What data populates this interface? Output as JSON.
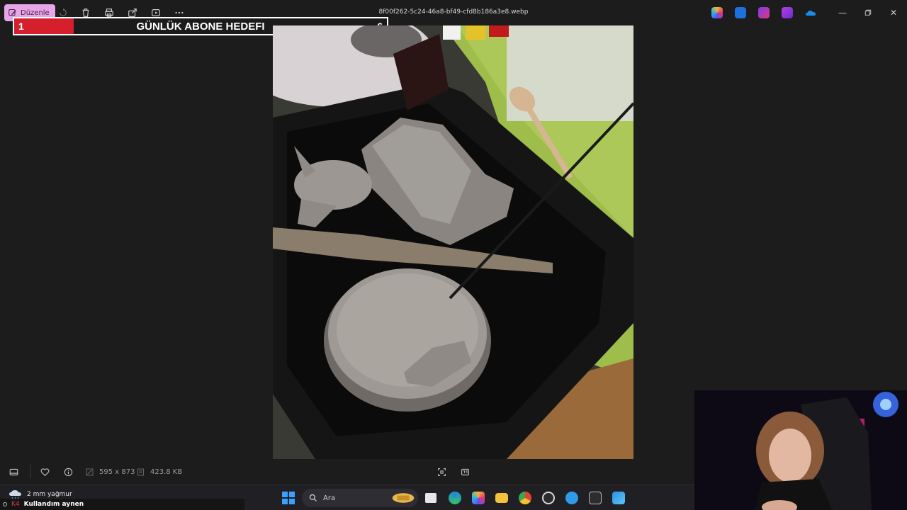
{
  "titlebar": {
    "edit_label": "Düzenle",
    "filename": "8f00f262-5c24-46a8-bf49-cfd8b186a3e8.webp",
    "tool_icons": [
      "rotate-icon",
      "delete-icon",
      "print-icon",
      "share-icon",
      "slideshow-icon",
      "more-icon"
    ],
    "tray_apps": [
      "copilot-icon",
      "photo-editor-icon",
      "clipchamp-icon",
      "designer-icon",
      "onedrive-icon"
    ],
    "window_controls": [
      "minimize",
      "restore",
      "close"
    ]
  },
  "goal": {
    "current": "1",
    "title": "GÜNLÜK ABONE HEDEFI",
    "target": "6",
    "fill_fraction": 0.16,
    "fill_color": "#d61f2c"
  },
  "infobar": {
    "dimensions": "595 x 873",
    "file_size": "423.8 KB"
  },
  "taskbar": {
    "weather_text": "2 mm yağmur",
    "search_placeholder": "Ara",
    "apps": [
      "file-explorer-icon",
      "task-view-icon",
      "edge-icon",
      "copilot-icon",
      "folder-icon",
      "chrome-icon",
      "obs-icon",
      "mail-icon",
      "terminal-icon",
      "photos-icon"
    ]
  },
  "ticker": {
    "user": "K4",
    "message": "Kullandım aynen"
  }
}
